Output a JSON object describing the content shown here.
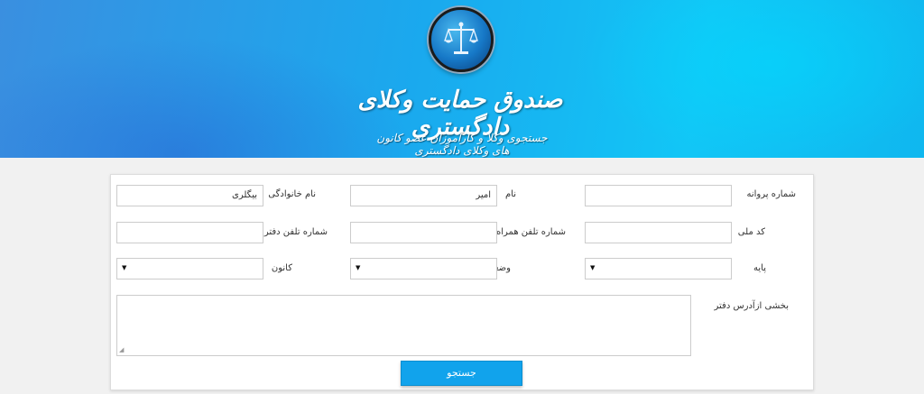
{
  "header": {
    "title": "صندوق حمایت وکلای دادگستری",
    "subtitle": "جستجوی وکلا و کارآموزان عضو کانون های وکلای دادگستری"
  },
  "form": {
    "license_number": {
      "label": "شماره پروانه",
      "value": ""
    },
    "first_name": {
      "label": "نام",
      "value": "امیر"
    },
    "last_name": {
      "label": "نام خانوادگی",
      "value": "بیگلری"
    },
    "national_code": {
      "label": "کد ملی",
      "value": ""
    },
    "mobile_phone": {
      "label": "شماره تلفن همراه",
      "value": ""
    },
    "office_phone": {
      "label": "شماره تلفن دفتر",
      "value": ""
    },
    "grade": {
      "label": "پایه",
      "value": ""
    },
    "status": {
      "label": "وضعیت",
      "value": ""
    },
    "bar_association": {
      "label": "کانون",
      "value": ""
    },
    "office_address": {
      "label": "بخشی ازآدرس دفتر",
      "value": ""
    },
    "search_button": "جستجو"
  },
  "colors": {
    "accent": "#11a3ec",
    "banner_start": "#3a8fe0",
    "banner_end": "#12c6f6"
  }
}
